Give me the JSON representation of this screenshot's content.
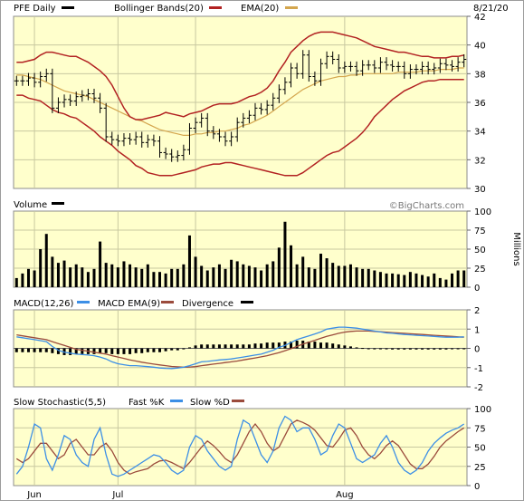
{
  "header": {
    "ticker_label": "PFE Daily",
    "bollinger_label": "Bollinger Bands(20)",
    "ema_label": "EMA(20)",
    "date_label": "8/21/20",
    "watermark": "©BigCharts.com"
  },
  "colors": {
    "panel_bg": "#ffffcc",
    "grid": "#c8c8a0",
    "bar": "#000000",
    "bollinger": "#b22222",
    "ema": "#d4a64e",
    "macd": "#3c8fe6",
    "macd_ema": "#9b4b3c"
  },
  "x_labels": [
    "Jun",
    "Jul",
    "Aug"
  ],
  "chart_data": [
    {
      "type": "ohlc",
      "title": "PFE Daily",
      "legend": [
        "Bollinger Bands(20)",
        "EMA(20)"
      ],
      "ylim": [
        30,
        42
      ],
      "yticks": [
        30,
        32,
        34,
        36,
        38,
        40,
        42
      ],
      "close": [
        37.5,
        37.5,
        37.7,
        37.4,
        37.8,
        38.0,
        35.6,
        36.0,
        36.2,
        36.1,
        36.4,
        36.5,
        36.6,
        36.3,
        35.6,
        33.6,
        33.4,
        33.3,
        33.5,
        33.4,
        33.6,
        33.2,
        33.4,
        33.3,
        32.5,
        32.4,
        32.2,
        32.3,
        32.7,
        34.2,
        34.6,
        34.9,
        34.0,
        33.8,
        33.6,
        33.3,
        33.6,
        34.6,
        34.9,
        35.1,
        35.6,
        35.5,
        35.8,
        36.3,
        36.9,
        37.4,
        38.4,
        38.0,
        39.3,
        37.8,
        37.5,
        38.7,
        39.2,
        39.0,
        38.4,
        38.5,
        38.5,
        38.2,
        38.6,
        38.6,
        38.4,
        38.8,
        38.6,
        38.5,
        38.5,
        38.0,
        38.3,
        38.3,
        38.5,
        38.3,
        38.4,
        38.7,
        38.6,
        38.5,
        38.8,
        39.0
      ],
      "bollinger_upper": [
        38.8,
        38.8,
        38.9,
        39.0,
        39.3,
        39.5,
        39.5,
        39.4,
        39.3,
        39.2,
        39.2,
        39.0,
        38.8,
        38.5,
        38.2,
        37.8,
        37.2,
        36.4,
        35.6,
        35.0,
        34.8,
        34.8,
        34.9,
        35.0,
        35.1,
        35.3,
        35.2,
        35.1,
        35.0,
        35.2,
        35.3,
        35.4,
        35.6,
        35.8,
        35.9,
        35.9,
        35.9,
        36.0,
        36.2,
        36.4,
        36.5,
        36.7,
        37.0,
        37.5,
        38.2,
        38.8,
        39.5,
        39.9,
        40.3,
        40.6,
        40.8,
        40.9,
        40.9,
        40.9,
        40.8,
        40.7,
        40.6,
        40.5,
        40.3,
        40.1,
        39.9,
        39.8,
        39.7,
        39.6,
        39.5,
        39.5,
        39.4,
        39.3,
        39.2,
        39.2,
        39.1,
        39.1,
        39.1,
        39.2,
        39.2,
        39.3
      ],
      "bollinger_lower": [
        36.5,
        36.5,
        36.3,
        36.2,
        36.1,
        35.8,
        35.5,
        35.3,
        35.2,
        35.0,
        34.9,
        34.6,
        34.3,
        34.0,
        33.6,
        33.3,
        33.0,
        32.6,
        32.3,
        32.0,
        31.6,
        31.4,
        31.1,
        31.0,
        30.9,
        30.9,
        30.9,
        31.0,
        31.1,
        31.2,
        31.3,
        31.5,
        31.6,
        31.7,
        31.7,
        31.8,
        31.8,
        31.7,
        31.6,
        31.5,
        31.4,
        31.3,
        31.2,
        31.1,
        31.0,
        30.9,
        30.9,
        30.9,
        31.1,
        31.4,
        31.7,
        32.0,
        32.3,
        32.5,
        32.6,
        32.9,
        33.2,
        33.5,
        33.9,
        34.4,
        35.0,
        35.4,
        35.8,
        36.2,
        36.5,
        36.8,
        37.0,
        37.2,
        37.4,
        37.5,
        37.5,
        37.6,
        37.6,
        37.6,
        37.6,
        37.6
      ],
      "ema": [
        37.9,
        37.9,
        37.8,
        37.7,
        37.6,
        37.4,
        37.2,
        37.0,
        36.8,
        36.7,
        36.6,
        36.5,
        36.4,
        36.2,
        36.0,
        35.8,
        35.6,
        35.4,
        35.2,
        35.0,
        34.8,
        34.7,
        34.5,
        34.3,
        34.1,
        34.0,
        33.9,
        33.8,
        33.7,
        33.7,
        33.8,
        33.8,
        33.9,
        33.9,
        34.0,
        34.0,
        34.1,
        34.2,
        34.4,
        34.5,
        34.7,
        34.9,
        35.1,
        35.4,
        35.7,
        36.0,
        36.3,
        36.6,
        36.9,
        37.1,
        37.3,
        37.5,
        37.6,
        37.7,
        37.8,
        37.8,
        37.9,
        37.9,
        38.0,
        38.0,
        38.0,
        38.0,
        38.0,
        38.0,
        38.1,
        38.1,
        38.1,
        38.1,
        38.2,
        38.2,
        38.2,
        38.3,
        38.3,
        38.3,
        38.4,
        38.4
      ]
    },
    {
      "type": "bar",
      "title": "Volume",
      "ylabel": "Millions",
      "ylim": [
        0,
        100
      ],
      "yticks": [
        0,
        25,
        50,
        75,
        100
      ],
      "values": [
        12,
        18,
        24,
        22,
        50,
        70,
        40,
        32,
        35,
        26,
        30,
        26,
        20,
        24,
        60,
        32,
        30,
        26,
        34,
        30,
        26,
        24,
        30,
        20,
        20,
        18,
        24,
        24,
        30,
        68,
        40,
        28,
        22,
        26,
        30,
        24,
        36,
        34,
        30,
        28,
        26,
        22,
        30,
        34,
        52,
        86,
        55,
        30,
        40,
        26,
        24,
        44,
        38,
        32,
        28,
        28,
        30,
        26,
        24,
        24,
        22,
        20,
        18,
        18,
        17,
        16,
        20,
        18,
        16,
        14,
        18,
        12,
        10,
        18,
        22,
        22
      ]
    },
    {
      "type": "line",
      "title": "MACD(12,26)",
      "legend": [
        "MACD EMA(9)",
        "Divergence"
      ],
      "ylim": [
        -2,
        2
      ],
      "yticks": [
        -2,
        -1,
        0,
        1,
        2
      ],
      "macd": [
        0.6,
        0.55,
        0.5,
        0.45,
        0.4,
        0.35,
        0.1,
        -0.1,
        -0.2,
        -0.25,
        -0.3,
        -0.32,
        -0.35,
        -0.38,
        -0.45,
        -0.55,
        -0.7,
        -0.8,
        -0.85,
        -0.9,
        -0.9,
        -0.92,
        -0.95,
        -0.98,
        -1.02,
        -1.04,
        -1.05,
        -1.02,
        -0.98,
        -0.9,
        -0.8,
        -0.7,
        -0.68,
        -0.64,
        -0.6,
        -0.58,
        -0.55,
        -0.5,
        -0.45,
        -0.4,
        -0.35,
        -0.3,
        -0.2,
        -0.1,
        0.05,
        0.15,
        0.3,
        0.45,
        0.55,
        0.65,
        0.75,
        0.85,
        1.0,
        1.05,
        1.1,
        1.1,
        1.08,
        1.05,
        1.0,
        0.95,
        0.9,
        0.85,
        0.8,
        0.78,
        0.75,
        0.72,
        0.7,
        0.68,
        0.66,
        0.64,
        0.62,
        0.6,
        0.58,
        0.58,
        0.58,
        0.6
      ],
      "macd_ema": [
        0.7,
        0.65,
        0.6,
        0.55,
        0.5,
        0.45,
        0.35,
        0.25,
        0.15,
        0.05,
        -0.05,
        -0.1,
        -0.15,
        -0.2,
        -0.25,
        -0.3,
        -0.38,
        -0.45,
        -0.52,
        -0.6,
        -0.66,
        -0.72,
        -0.77,
        -0.82,
        -0.86,
        -0.9,
        -0.94,
        -0.96,
        -0.98,
        -0.97,
        -0.95,
        -0.9,
        -0.86,
        -0.82,
        -0.78,
        -0.74,
        -0.7,
        -0.66,
        -0.6,
        -0.55,
        -0.5,
        -0.44,
        -0.38,
        -0.3,
        -0.22,
        -0.12,
        -0.02,
        0.1,
        0.22,
        0.32,
        0.42,
        0.52,
        0.62,
        0.7,
        0.78,
        0.84,
        0.88,
        0.9,
        0.9,
        0.9,
        0.88,
        0.86,
        0.84,
        0.82,
        0.8,
        0.78,
        0.76,
        0.74,
        0.72,
        0.7,
        0.68,
        0.66,
        0.64,
        0.62,
        0.6,
        0.58
      ],
      "divergence": [
        -0.2,
        -0.2,
        -0.2,
        -0.2,
        -0.2,
        -0.2,
        -0.25,
        -0.3,
        -0.35,
        -0.35,
        -0.3,
        -0.3,
        -0.3,
        -0.3,
        -0.25,
        -0.25,
        -0.3,
        -0.3,
        -0.3,
        -0.3,
        -0.25,
        -0.25,
        -0.2,
        -0.2,
        -0.2,
        -0.15,
        -0.1,
        -0.1,
        -0.05,
        0.05,
        0.15,
        0.2,
        0.2,
        0.2,
        0.2,
        0.2,
        0.2,
        0.2,
        0.2,
        0.2,
        0.25,
        0.25,
        0.3,
        0.3,
        0.3,
        0.35,
        0.35,
        0.4,
        0.4,
        0.35,
        0.35,
        0.3,
        0.3,
        0.25,
        0.2,
        0.15,
        0.1,
        0.05,
        0.02,
        -0.02,
        -0.05,
        -0.05,
        -0.05,
        -0.06,
        -0.06,
        -0.06,
        -0.06,
        -0.06,
        -0.06,
        -0.06,
        -0.06,
        -0.06,
        -0.06,
        -0.04,
        -0.02,
        0.0
      ]
    },
    {
      "type": "line",
      "title": "Slow Stochastic(5,5)",
      "legend": [
        "Fast %K",
        "Slow %D"
      ],
      "ylim": [
        0,
        100
      ],
      "yticks": [
        0,
        25,
        50,
        75,
        100
      ],
      "fast_k": [
        15,
        25,
        50,
        80,
        75,
        35,
        20,
        40,
        65,
        60,
        40,
        30,
        25,
        60,
        75,
        40,
        15,
        12,
        15,
        20,
        25,
        30,
        35,
        40,
        38,
        30,
        20,
        15,
        20,
        50,
        65,
        60,
        45,
        35,
        25,
        20,
        25,
        60,
        85,
        80,
        60,
        40,
        30,
        45,
        75,
        90,
        85,
        70,
        75,
        75,
        60,
        40,
        45,
        65,
        80,
        75,
        55,
        35,
        30,
        35,
        40,
        55,
        65,
        50,
        30,
        20,
        15,
        20,
        30,
        45,
        55,
        62,
        68,
        72,
        75,
        80
      ],
      "slow_d": [
        35,
        30,
        35,
        45,
        55,
        55,
        45,
        35,
        40,
        55,
        60,
        50,
        40,
        40,
        50,
        55,
        45,
        30,
        20,
        15,
        18,
        20,
        22,
        28,
        32,
        33,
        30,
        26,
        22,
        30,
        40,
        50,
        58,
        52,
        44,
        35,
        30,
        40,
        55,
        70,
        80,
        70,
        55,
        45,
        50,
        65,
        80,
        85,
        82,
        78,
        72,
        62,
        52,
        50,
        60,
        72,
        75,
        65,
        50,
        40,
        35,
        42,
        52,
        58,
        52,
        40,
        28,
        22,
        22,
        28,
        38,
        50,
        58,
        64,
        70,
        75
      ]
    }
  ]
}
